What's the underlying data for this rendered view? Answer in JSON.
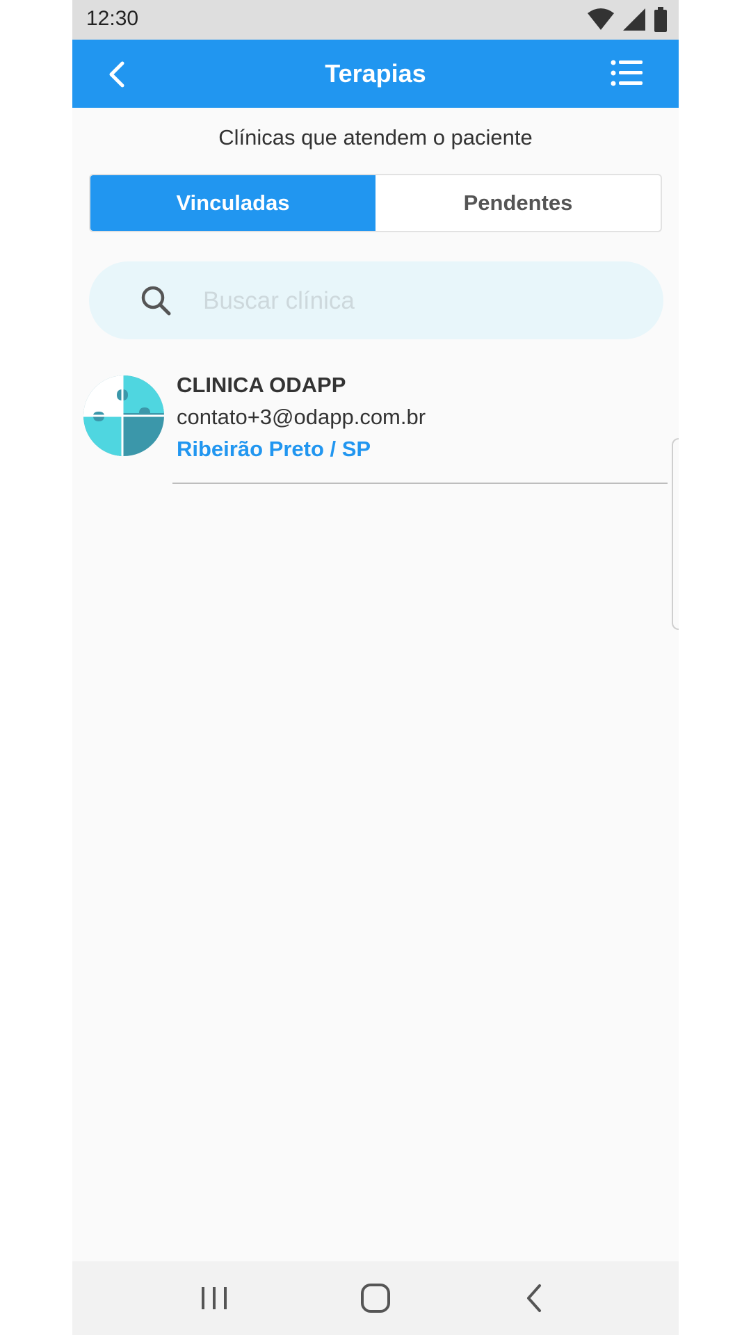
{
  "status_bar": {
    "time": "12:30",
    "icons": [
      "wifi-icon",
      "signal-icon",
      "battery-icon"
    ]
  },
  "app_bar": {
    "title": "Terapias",
    "back_icon": "chevron-left-icon",
    "menu_icon": "list-menu-icon",
    "color": "#2196f0"
  },
  "subtitle": "Clínicas que atendem o paciente",
  "tabs": [
    {
      "label": "Vinculadas",
      "active": true
    },
    {
      "label": "Pendentes",
      "active": false
    }
  ],
  "search": {
    "placeholder": "Buscar clínica",
    "value": "",
    "icon": "search-icon"
  },
  "clinics": [
    {
      "name": "CLINICA ODAPP",
      "email": "contato+3@odapp.com.br",
      "city": "Ribeirão Preto / SP",
      "avatar_icon": "puzzle-icon"
    }
  ],
  "nav_bar": {
    "icons": [
      "recent-apps-icon",
      "home-icon",
      "back-icon"
    ]
  },
  "colors": {
    "accent": "#2196f0",
    "search_bg": "#e8f6fa",
    "puzzle_light": "#4fd6e0",
    "puzzle_dark": "#3b97aa"
  }
}
